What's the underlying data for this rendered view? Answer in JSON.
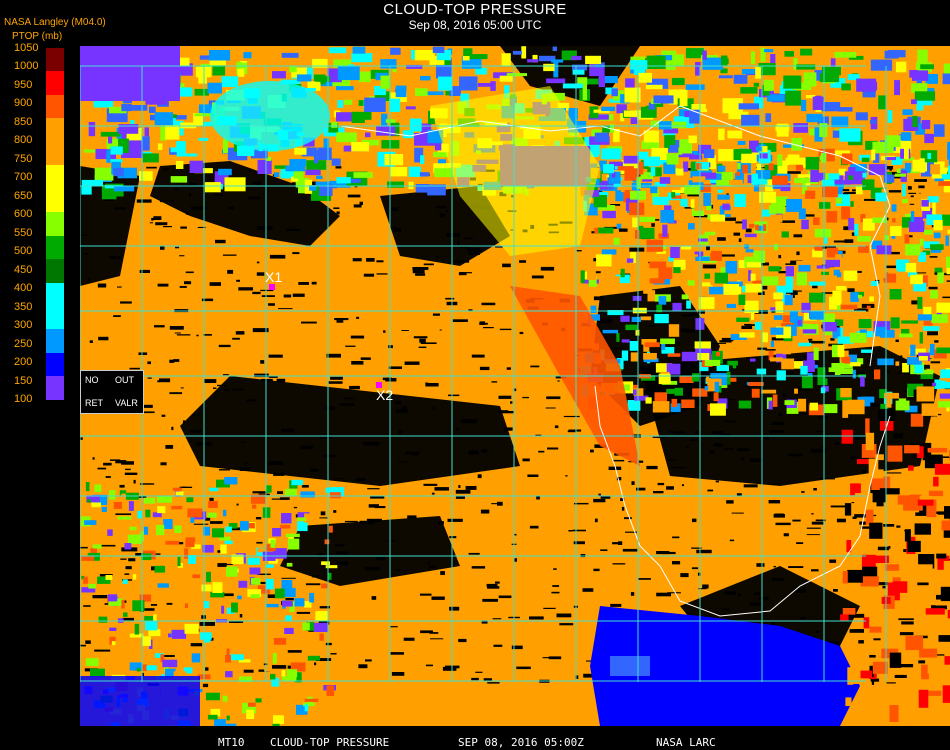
{
  "header": {
    "title": "CLOUD-TOP PRESSURE",
    "subtitle": "Sep 08, 2016 05:00 UTC",
    "source": "NASA Langley (M04.0)",
    "unit": "PTOP (mb)"
  },
  "colorbar": {
    "ticks": [
      "1050",
      "1000",
      "950",
      "900",
      "850",
      "800",
      "750",
      "700",
      "650",
      "600",
      "550",
      "500",
      "450",
      "400",
      "350",
      "300",
      "250",
      "200",
      "150",
      "100"
    ],
    "swatches": [
      "#7a0000",
      "#ff0000",
      "#ff5500",
      "#ffa000",
      "#ffa000",
      "#ffff00",
      "#ffff00",
      "#88ff00",
      "#00aa00",
      "#007700",
      "#00ffff",
      "#00ffff",
      "#0099ff",
      "#0000ff",
      "#7733ff"
    ]
  },
  "no_retrieval_box": {
    "line1_left": "NO",
    "line1_right": "OUT",
    "line2_left": "RET",
    "line2_right": "VALR"
  },
  "markers": [
    {
      "label": "X1",
      "color": "#ff00ff"
    },
    {
      "label": "X2",
      "color": "#ff00ff"
    }
  ],
  "footer": {
    "product": "MT10",
    "name": "CLOUD-TOP PRESSURE",
    "datetime": "SEP 08, 2016 05:00Z",
    "org": "NASA LARC"
  },
  "map_colors": {
    "ocean_low": "#ffa000",
    "high": "#7733ff",
    "clear": "#000000",
    "grid": "#40e0d0",
    "coast": "#ffffff"
  }
}
